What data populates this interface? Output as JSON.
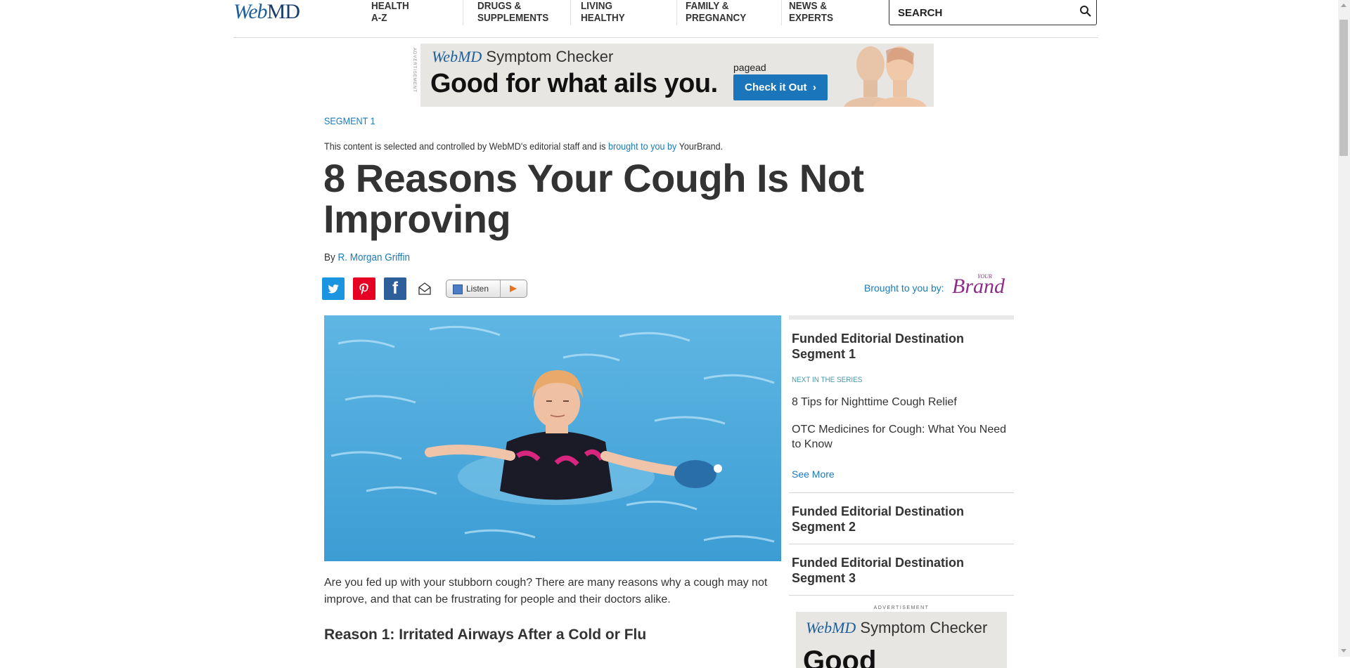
{
  "header": {
    "logo_web": "Web",
    "logo_md": "MD",
    "nav": [
      {
        "line1": "HEALTH",
        "line2": "A-Z"
      },
      {
        "line1": "DRUGS &",
        "line2": "SUPPLEMENTS"
      },
      {
        "line1": "LIVING",
        "line2": "HEALTHY"
      },
      {
        "line1": "FAMILY &",
        "line2": "PREGNANCY"
      },
      {
        "line1": "NEWS &",
        "line2": "EXPERTS"
      }
    ],
    "search_placeholder": "SEARCH"
  },
  "top_ad": {
    "label": "ADVERTISEMENT",
    "brand_logo": "WebMD",
    "brand_text": "Symptom Checker",
    "headline": "Good for what ails you.",
    "pagead": "pagead",
    "cta": "Check it Out"
  },
  "article": {
    "segment": "SEGMENT 1",
    "disclaimer_pre": "This content is selected and controlled by WebMD's editorial staff and is ",
    "disclaimer_link": "brought to you by",
    "disclaimer_post": " YourBrand.",
    "title": "8 Reasons Your Cough Is Not Improving",
    "by": "By",
    "author": "R. Morgan Griffin",
    "listen": "Listen",
    "brought_to_you_by": "Brought to you by:",
    "sponsor_your": "YOUR",
    "sponsor_brand": "Brand",
    "intro": "Are you fed up with your stubborn cough? There are many reasons why a cough may not improve, and that can be frustrating for people and their doctors alike.",
    "reason1": "Reason 1: Irritated Airways After a Cold or Flu"
  },
  "sidebar": {
    "segment1": "Funded Editorial Destination Segment 1",
    "next_label": "NEXT IN THE SERIES",
    "links": [
      "8 Tips for Nighttime Cough Relief",
      "OTC Medicines for Cough: What You Need to Know"
    ],
    "see_more": "See More",
    "segment2": "Funded Editorial Destination Segment 2",
    "segment3": "Funded Editorial Destination Segment 3",
    "ad_label": "ADVERTISEMENT",
    "ad_brand_logo": "WebMD",
    "ad_brand_text": "Symptom Checker",
    "ad_big": "Good"
  },
  "colors": {
    "link": "#1c7ab8",
    "twitter": "#1b95e0",
    "pinterest": "#e60023",
    "facebook": "#2d5f9a",
    "cta": "#1b75bb"
  }
}
